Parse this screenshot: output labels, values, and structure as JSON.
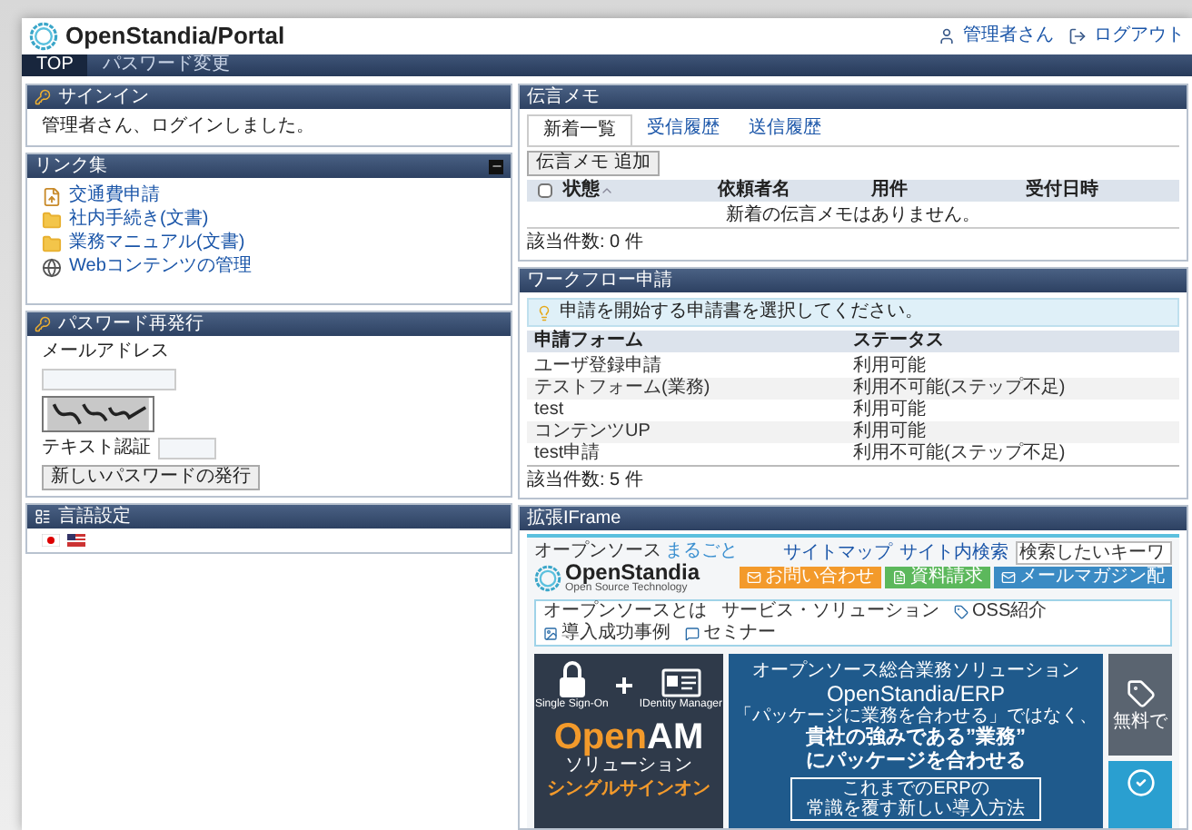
{
  "header": {
    "logo": "OpenStandia/Portal",
    "user_link": "管理者さん",
    "logout_link": "ログアウト"
  },
  "nav": [
    {
      "label": "TOP",
      "selected": true
    },
    {
      "label": "パスワード変更",
      "selected": false
    }
  ],
  "signin": {
    "title": "サインイン",
    "message": "管理者さん、ログインしました。"
  },
  "links": {
    "title": "リンク集",
    "items": [
      {
        "kind": "upload",
        "label": "交通費申請"
      },
      {
        "kind": "folder",
        "label": "社内手続き(文書)"
      },
      {
        "kind": "folder",
        "label": "業務マニュアル(文書)"
      },
      {
        "kind": "web",
        "label": "Webコンテンツの管理"
      }
    ]
  },
  "password_reissue": {
    "title": "パスワード再発行",
    "email_label": "メールアドレス",
    "captcha_label": "テキスト認証",
    "button": "新しいパスワードの発行"
  },
  "language": {
    "title": "言語設定"
  },
  "memo": {
    "title": "伝言メモ",
    "tabs": [
      {
        "label": "新着一覧",
        "selected": true
      },
      {
        "label": "受信履歴",
        "selected": false
      },
      {
        "label": "送信履歴",
        "selected": false
      }
    ],
    "add_button": "伝言メモ 追加",
    "select_all_checked": false,
    "columns": [
      "状態",
      "依頼者名",
      "用件",
      "受付日時"
    ],
    "empty": "新着の伝言メモはありません。",
    "count": "該当件数: 0 件"
  },
  "workflow": {
    "title": "ワークフロー申請",
    "notice": "申請を開始する申請書を選択してください。",
    "columns": [
      "申請フォーム",
      "ステータス"
    ],
    "rows": [
      {
        "form": "ユーザ登録申請",
        "status": "利用可能"
      },
      {
        "form": "テストフォーム(業務)",
        "status": "利用不可能(ステップ不足)"
      },
      {
        "form": "test",
        "status": "利用可能"
      },
      {
        "form": "コンテンツUP",
        "status": "利用可能"
      },
      {
        "form": "test申請",
        "status": "利用不可能(ステップ不足)"
      }
    ],
    "count": "該当件数: 5 件"
  },
  "iframe": {
    "title": "拡張IFrame",
    "tagline": "オープンソース",
    "tagline_marks": "まるごと",
    "logo": "OpenStandia",
    "logo_sub": "Open Source Technology",
    "top_links": [
      "サイトマップ",
      "サイト内検索"
    ],
    "search_value": "検索したいキーワ",
    "buttons": [
      {
        "label": "お問い合わせ",
        "color": "#f39a2b"
      },
      {
        "label": "資料請求",
        "color": "#5cb85c"
      },
      {
        "label": "メールマガジン配",
        "color": "#3b8bc4"
      }
    ],
    "menu": [
      "オープンソースとは",
      "サービス・ソリューション",
      "OSS紹介",
      "導入成功事例",
      "セミナー"
    ],
    "banner_sso": {
      "left_caption": "Single Sign-On",
      "right_caption": "IDentity Manager",
      "product_open": "Open",
      "product_am": "AM",
      "product_sub": "ソリューション",
      "headline": "シングルサインオン"
    },
    "banner_erp": {
      "kicker": "オープンソース総合業務ソリューション",
      "product": "OpenStandia/ERP",
      "lead": "「パッケージに業務を合わせる」ではなく、",
      "headline_1": "貴社の強みである”業務”",
      "headline_2": "にパッケージを合わせる",
      "box_1": "これまでのERPの",
      "box_2": "常識を覆す新しい導入方法"
    },
    "banner_side": {
      "caption": "無料で"
    }
  }
}
